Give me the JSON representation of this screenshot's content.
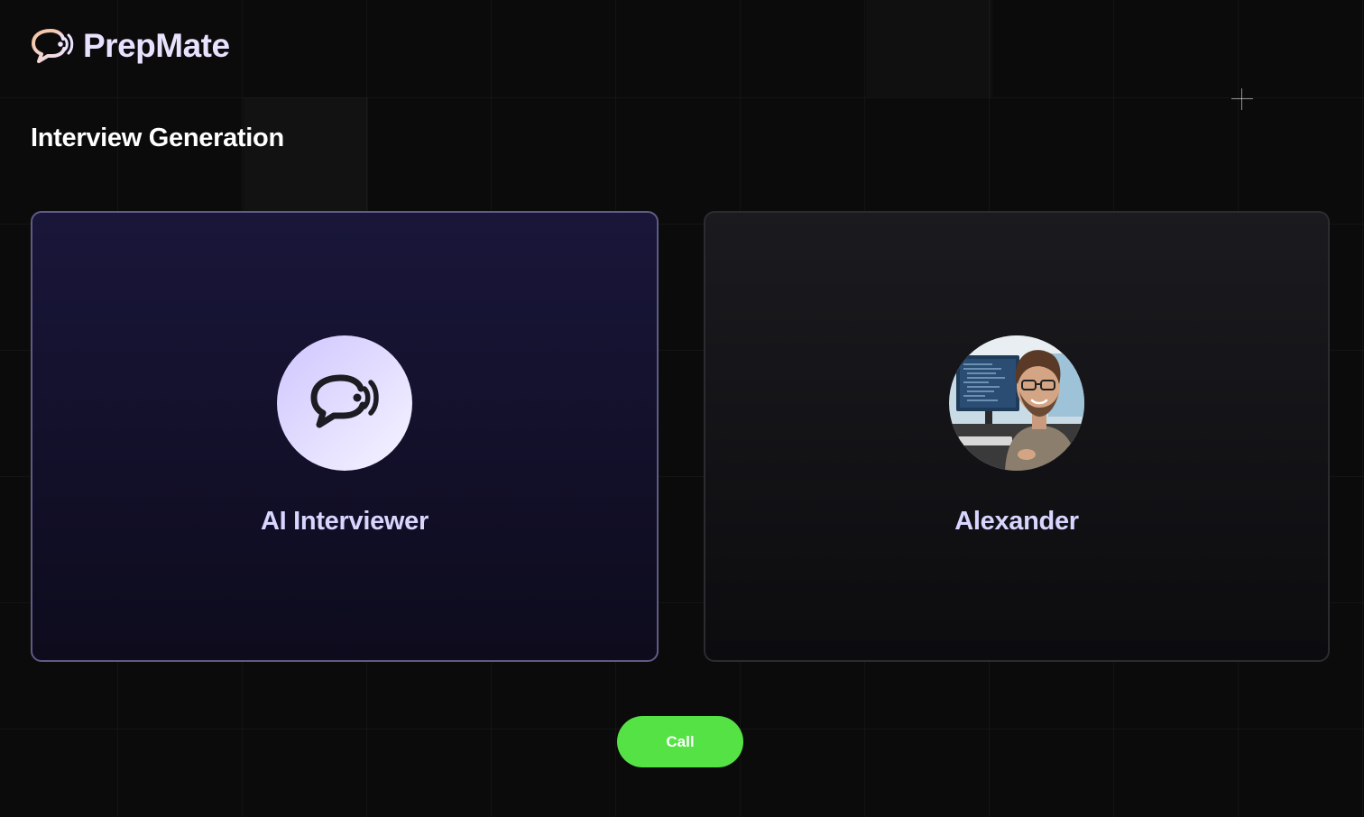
{
  "brand": {
    "name": "PrepMate",
    "icon": "chat-wave-icon"
  },
  "page": {
    "title": "Interview Generation"
  },
  "cards": [
    {
      "label": "AI Interviewer",
      "icon": "ai-chat-wave-icon",
      "selected": true
    },
    {
      "label": "Alexander",
      "icon": "user-avatar-photo",
      "selected": false
    }
  ],
  "actions": {
    "call_label": "Call"
  },
  "colors": {
    "background": "#0b0b0b",
    "brand_text": "#e9e2ff",
    "brand_icon": "#f6c9a8",
    "card_label": "#d8d5ff",
    "ai_card_border": "#5e5b86",
    "call_button": "#55e245"
  }
}
